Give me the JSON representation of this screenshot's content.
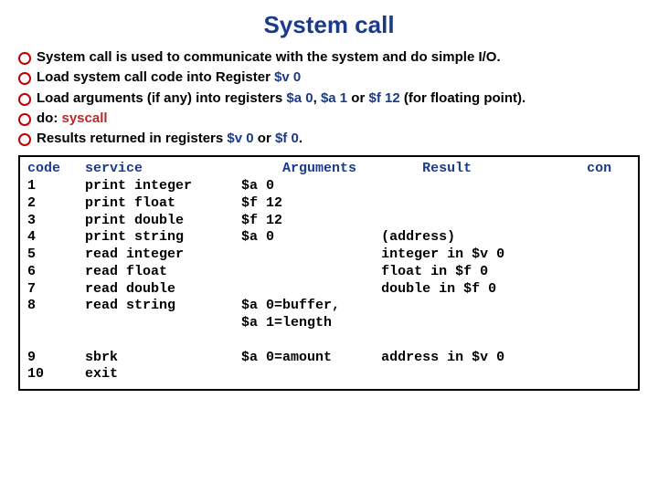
{
  "title": "System call",
  "bullets": [
    {
      "text_parts": [
        {
          "t": "System call is used to communicate with the system and do simple I/O.",
          "c": ""
        }
      ]
    },
    {
      "text_parts": [
        {
          "t": "Load  system call code into Register ",
          "c": ""
        },
        {
          "t": "$v 0",
          "c": "blue"
        }
      ]
    },
    {
      "text_parts": [
        {
          "t": "Load arguments (if any) into registers ",
          "c": ""
        },
        {
          "t": "$a 0",
          "c": "blue"
        },
        {
          "t": ", ",
          "c": ""
        },
        {
          "t": "$a 1",
          "c": "blue"
        },
        {
          "t": " or ",
          "c": ""
        },
        {
          "t": "$f 12",
          "c": "blue"
        },
        {
          "t": " (for floating point).",
          "c": ""
        }
      ]
    },
    {
      "text_parts": [
        {
          "t": "do:     ",
          "c": ""
        },
        {
          "t": "syscall",
          "c": "red"
        }
      ]
    },
    {
      "text_parts": [
        {
          "t": "Results returned in registers ",
          "c": ""
        },
        {
          "t": "$v 0",
          "c": "blue"
        },
        {
          "t": " or ",
          "c": ""
        },
        {
          "t": "$f 0",
          "c": "blue"
        },
        {
          "t": ".",
          "c": ""
        }
      ]
    }
  ],
  "table": {
    "header": {
      "code": "code",
      "service": "service",
      "arguments": "Arguments",
      "result": "Result",
      "tail": "con"
    },
    "rows": [
      {
        "code": "1",
        "service": "print integer",
        "args": "$a 0",
        "result": ""
      },
      {
        "code": "2",
        "service": "print float",
        "args": "$f 12",
        "result": ""
      },
      {
        "code": "3",
        "service": "print double",
        "args": "$f 12",
        "result": ""
      },
      {
        "code": "4",
        "service": "print string",
        "args": "$a 0",
        "result": "(address)"
      },
      {
        "code": "5",
        "service": "read integer",
        "args": "",
        "result": "integer in $v 0"
      },
      {
        "code": "6",
        "service": "read float",
        "args": "",
        "result": "float in $f 0"
      },
      {
        "code": "7",
        "service": "read double",
        "args": "",
        "result": "double in $f 0"
      },
      {
        "code": "8",
        "service": "read string",
        "args": "$a 0=buffer,",
        "result": ""
      },
      {
        "code": "",
        "service": "",
        "args": "$a 1=length",
        "result": ""
      },
      {
        "code": "9",
        "service": "sbrk",
        "args": "$a 0=amount",
        "result": "address in $v 0"
      },
      {
        "code": "10",
        "service": "exit",
        "args": "",
        "result": ""
      }
    ]
  }
}
